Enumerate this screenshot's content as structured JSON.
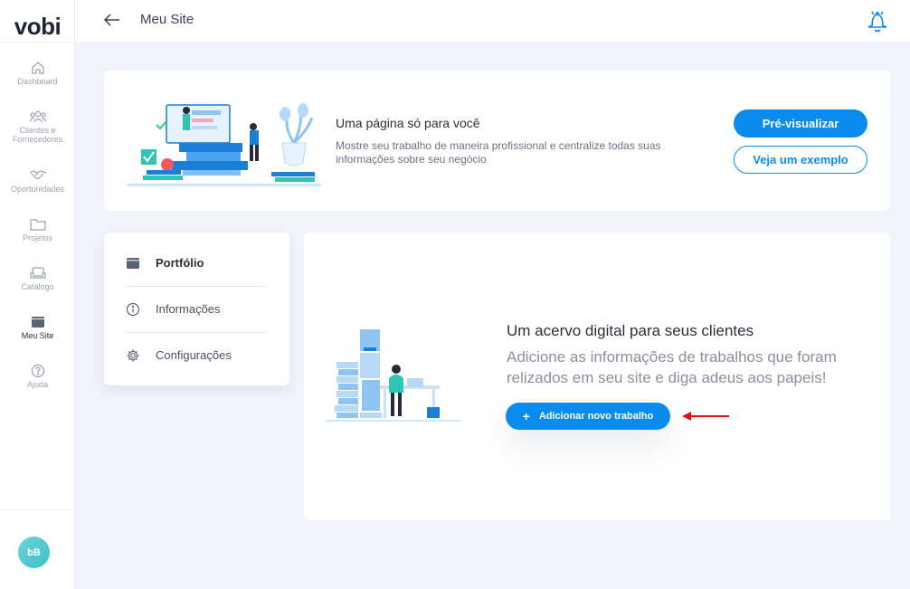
{
  "sidebar": {
    "logo": "vobi",
    "items": [
      {
        "label": "Dashboard",
        "icon": "home-icon"
      },
      {
        "label": "Clientes e Fornecedores",
        "icon": "users-icon"
      },
      {
        "label": "Oportunidades",
        "icon": "handshake-icon"
      },
      {
        "label": "Projetos",
        "icon": "folder-icon"
      },
      {
        "label": "Catálogo",
        "icon": "sofa-icon"
      },
      {
        "label": "Meu Site",
        "icon": "browser-icon",
        "active": true
      },
      {
        "label": "Ajuda",
        "icon": "help-icon"
      }
    ],
    "avatar_initials": "bB"
  },
  "topbar": {
    "title": "Meu Site",
    "back_icon": "arrow-left-icon",
    "notification_icon": "bell-icon"
  },
  "hero": {
    "title": "Uma página só para você",
    "description": "Mostre seu trabalho de maneira profissional e centralize todas suas informações sobre seu negócio",
    "preview_button": "Pré-visualizar",
    "example_button": "Veja um exemplo"
  },
  "menu": {
    "items": [
      {
        "label": "Portfólio",
        "icon": "browser-icon",
        "active": true
      },
      {
        "label": "Informações",
        "icon": "info-icon"
      },
      {
        "label": "Configurações",
        "icon": "gear-icon"
      }
    ]
  },
  "main": {
    "title": "Um acervo digital para seus clientes",
    "description": "Adicione as informações de trabalhos que foram relizados em seu site e diga adeus aos papeis!",
    "add_button": "Adicionar novo trabalho"
  },
  "colors": {
    "accent": "#0a8bf0",
    "background": "#f0f3fa",
    "arrow": "#e0101a",
    "avatar": "#3cc0c8"
  }
}
